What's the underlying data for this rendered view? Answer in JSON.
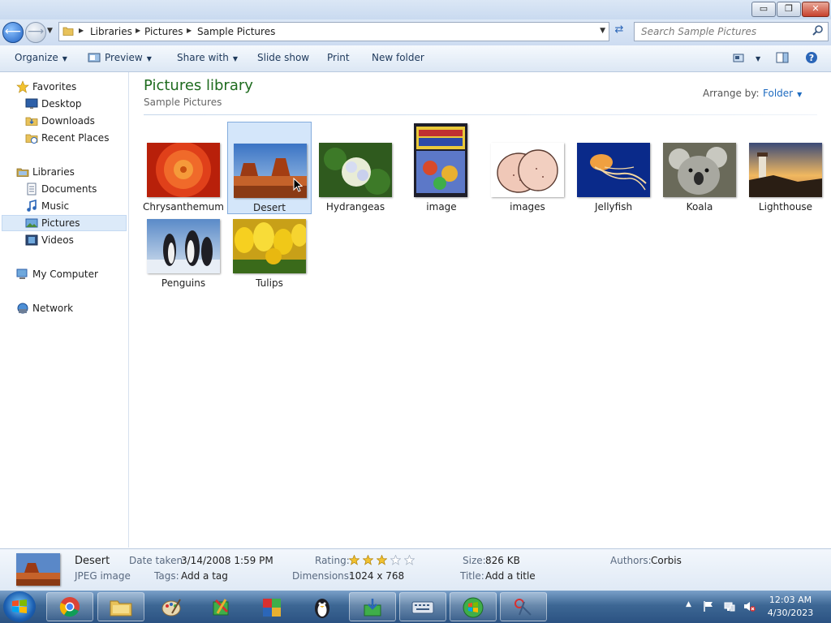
{
  "window": {
    "controls": {
      "minimize": "▭",
      "maximize": "❐",
      "close": "✕"
    }
  },
  "address": {
    "crumbs": [
      "Libraries",
      "Pictures",
      "Sample Pictures"
    ],
    "search_placeholder": "Search Sample Pictures"
  },
  "toolbar": {
    "organize": "Organize",
    "preview": "Preview",
    "share_with": "Share with",
    "slide_show": "Slide show",
    "print": "Print",
    "new_folder": "New folder"
  },
  "sidebar": {
    "favorites": "Favorites",
    "desktop": "Desktop",
    "downloads": "Downloads",
    "recent_places": "Recent Places",
    "libraries": "Libraries",
    "documents": "Documents",
    "music": "Music",
    "pictures": "Pictures",
    "videos": "Videos",
    "my_computer": "My Computer",
    "network": "Network"
  },
  "library": {
    "title": "Pictures library",
    "subtitle": "Sample Pictures",
    "arrange_label": "Arrange by:",
    "arrange_value": "Folder"
  },
  "files": [
    {
      "name": "Chrysanthemum"
    },
    {
      "name": "Desert"
    },
    {
      "name": "Hydrangeas"
    },
    {
      "name": "image"
    },
    {
      "name": "images"
    },
    {
      "name": "Jellyfish"
    },
    {
      "name": "Koala"
    },
    {
      "name": "Lighthouse"
    },
    {
      "name": "Penguins"
    },
    {
      "name": "Tulips"
    }
  ],
  "selected_file": "Desert",
  "details": {
    "name": "Desert",
    "type": "JPEG image",
    "date_taken_label": "Date taken:",
    "date_taken": "3/14/2008 1:59 PM",
    "tags_label": "Tags:",
    "tags": "Add a tag",
    "rating_label": "Rating:",
    "rating": 3,
    "rating_max": 5,
    "dimensions_label": "Dimensions:",
    "dimensions": "1024 x 768",
    "size_label": "Size:",
    "size": "826 KB",
    "title_label": "Title:",
    "title": "Add a title",
    "authors_label": "Authors:",
    "authors": "Corbis"
  },
  "taskbar": {
    "time": "12:03 AM",
    "date": "4/30/2023"
  }
}
